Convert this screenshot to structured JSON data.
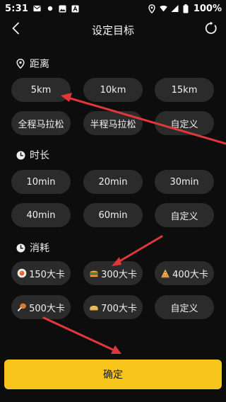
{
  "status_bar": {
    "time": "5:31",
    "battery": "100%",
    "icons": [
      "mail-icon",
      "dot-icon",
      "photo-icon",
      "text-app-icon",
      "location-icon",
      "wifi-icon",
      "signal-icon",
      "battery-icon"
    ]
  },
  "header": {
    "title": "设定目标",
    "back_icon": "chevron-left-icon",
    "reset_icon": "refresh-icon"
  },
  "sections": {
    "distance": {
      "title": "距离",
      "icon": "location-pin-icon",
      "options": [
        "5km",
        "10km",
        "15km",
        "全程马拉松",
        "半程马拉松",
        "自定义"
      ]
    },
    "duration": {
      "title": "时长",
      "icon": "clock-icon",
      "options": [
        "10min",
        "20min",
        "30min",
        "40min",
        "60min",
        "自定义"
      ]
    },
    "calories": {
      "title": "消耗",
      "icon": "clock-icon",
      "options": [
        {
          "label": "150大卡",
          "icon": "egg-icon"
        },
        {
          "label": "300大卡",
          "icon": "burger-icon"
        },
        {
          "label": "400大卡",
          "icon": "pizza-icon"
        },
        {
          "label": "500大卡",
          "icon": "drumstick-icon"
        },
        {
          "label": "700大卡",
          "icon": "cake-icon"
        },
        {
          "label": "自定义",
          "icon": ""
        }
      ]
    }
  },
  "confirm_label": "确定",
  "colors": {
    "background": "#0d0d0d",
    "pill": "#2b2b2b",
    "accent": "#f7c51c",
    "annotation_arrow": "#e0383a"
  }
}
